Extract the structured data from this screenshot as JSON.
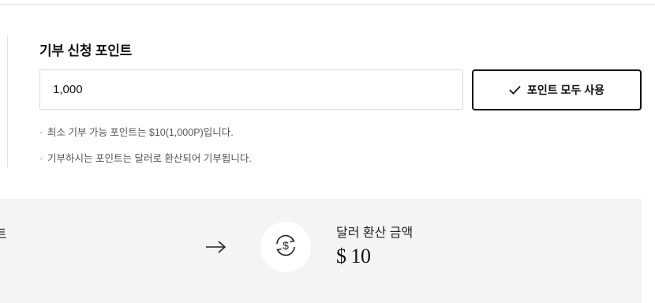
{
  "donation": {
    "title": "기부 신청 포인트",
    "input_value": "1,000",
    "use_all_label": "포인트 모두 사용",
    "notes": [
      "최소 기부 가능 포인트는 $10(1,000P)입니다.",
      "기부하시는 포인트는 달러로 환산되어 기부됩니다."
    ]
  },
  "conversion": {
    "left_label_partial": "트",
    "result_title": "달러 환산 금액",
    "result_amount": "$ 10"
  },
  "icons": [
    "check-icon",
    "arrow-right-icon",
    "dollar-exchange-icon"
  ],
  "colors": {
    "panel_bg": "#f4f4f4",
    "border": "#d9d9d9",
    "button_border": "#111111"
  }
}
